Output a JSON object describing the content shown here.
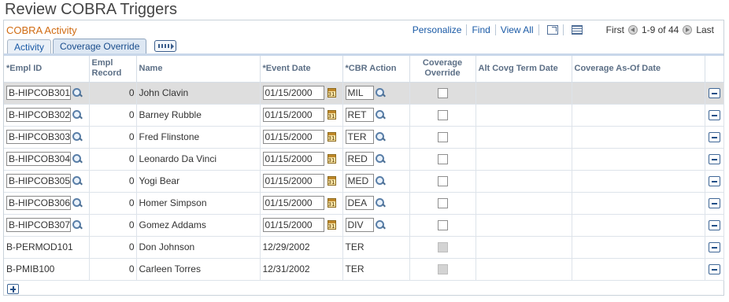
{
  "page": {
    "title": "Review COBRA Triggers"
  },
  "grid": {
    "caption": "COBRA Activity",
    "nav": {
      "personalize": "Personalize",
      "find": "Find",
      "view_all": "View All",
      "first": "First",
      "range": "1-9 of 44",
      "last": "Last",
      "zoom_icon": "new-window-icon",
      "download_icon": "download-grid-icon"
    },
    "tabs": [
      {
        "label": "Activity",
        "active": false
      },
      {
        "label": "Coverage Override",
        "active": true
      }
    ],
    "columns": {
      "empl_id": "*Empl ID",
      "empl_record": "Empl Record",
      "name": "Name",
      "event_date": "*Event Date",
      "cbr_action": "*CBR Action",
      "coverage_override": "Coverage Override",
      "alt_covg_term_date": "Alt Covg Term Date",
      "coverage_as_of_date": "Coverage As-Of Date"
    },
    "rows": [
      {
        "empl_id": "B-HIPCOB301",
        "empl_record": "0",
        "name": "John Clavin",
        "event_date": "01/15/2000",
        "cbr_action": "MIL",
        "editable": true
      },
      {
        "empl_id": "B-HIPCOB302",
        "empl_record": "0",
        "name": "Barney Rubble",
        "event_date": "01/15/2000",
        "cbr_action": "RET",
        "editable": true
      },
      {
        "empl_id": "B-HIPCOB303",
        "empl_record": "0",
        "name": "Fred Flinstone",
        "event_date": "01/15/2000",
        "cbr_action": "TER",
        "editable": true
      },
      {
        "empl_id": "B-HIPCOB304",
        "empl_record": "0",
        "name": "Leonardo Da Vinci",
        "event_date": "01/15/2000",
        "cbr_action": "RED",
        "editable": true
      },
      {
        "empl_id": "B-HIPCOB305",
        "empl_record": "0",
        "name": "Yogi Bear",
        "event_date": "01/15/2000",
        "cbr_action": "MED",
        "editable": true
      },
      {
        "empl_id": "B-HIPCOB306",
        "empl_record": "0",
        "name": "Homer Simpson",
        "event_date": "01/15/2000",
        "cbr_action": "DEA",
        "editable": true
      },
      {
        "empl_id": "B-HIPCOB307",
        "empl_record": "0",
        "name": "Gomez Addams",
        "event_date": "01/15/2000",
        "cbr_action": "DIV",
        "editable": true
      },
      {
        "empl_id": "B-PERMOD101",
        "empl_record": "0",
        "name": "Don Johnson",
        "event_date": "12/29/2002",
        "cbr_action": "TER",
        "editable": false
      },
      {
        "empl_id": "B-PMIB100",
        "empl_record": "0",
        "name": "Carleen Torres",
        "event_date": "12/31/2002",
        "cbr_action": "TER",
        "editable": false
      }
    ],
    "colors": {
      "caption": "#d06b12",
      "link": "#1a5aa6",
      "header_text": "#5c6f86",
      "selected_row": "#dedede"
    }
  }
}
